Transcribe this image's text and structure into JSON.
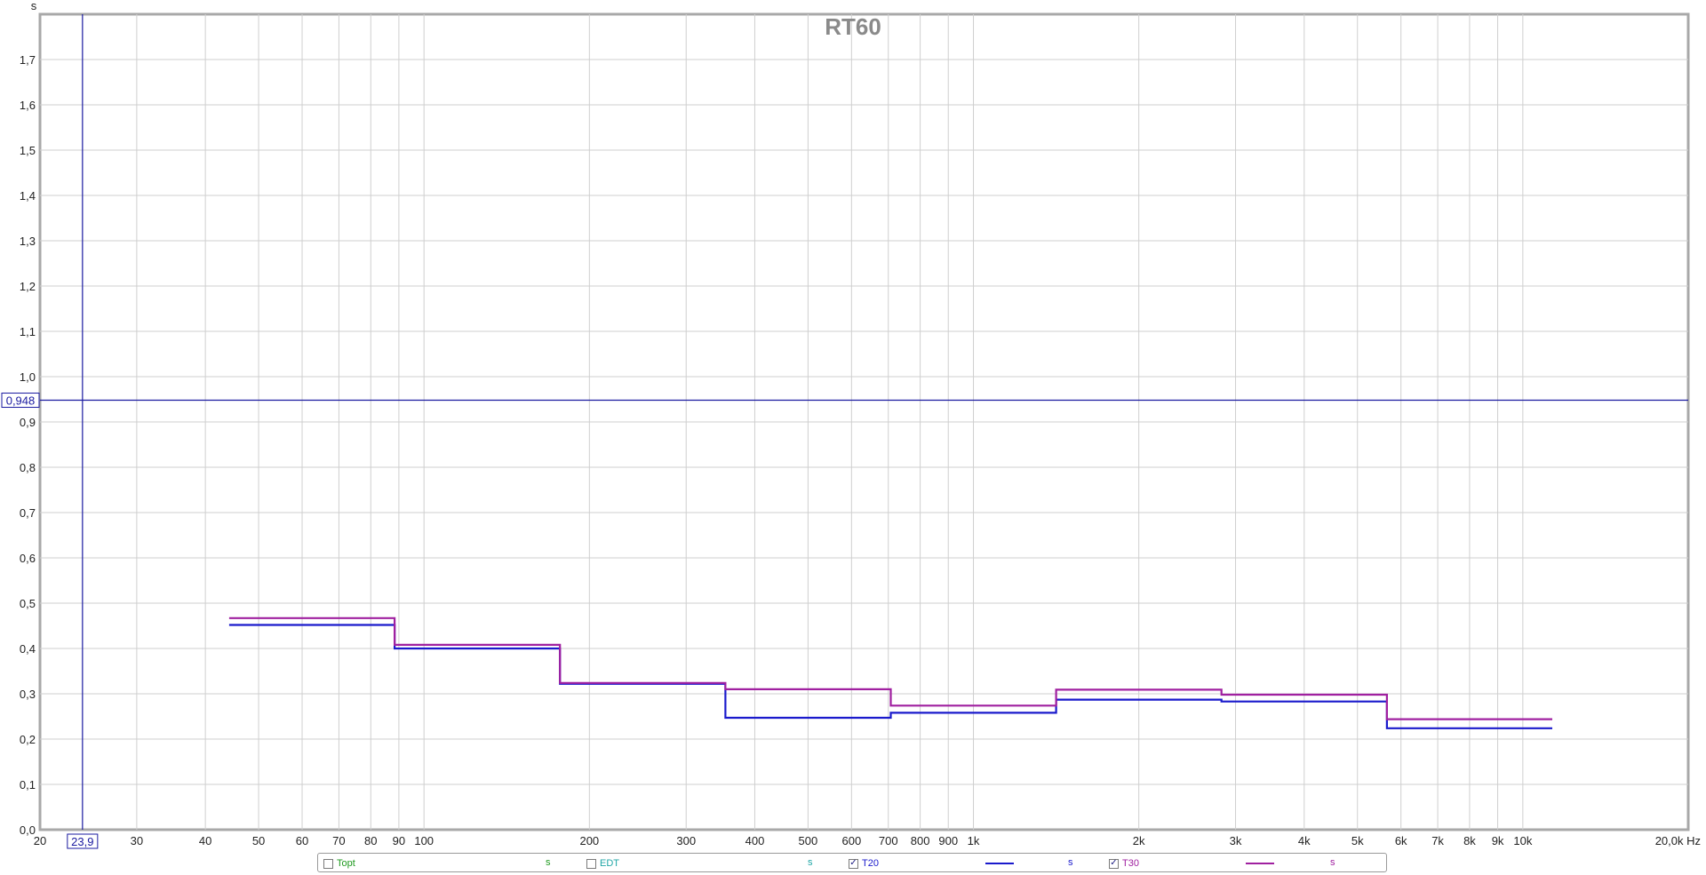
{
  "chart_data": {
    "type": "line",
    "title": "RT60",
    "ylabel": "s",
    "xlabel": "Hz",
    "x_scale": "log",
    "xlim": [
      20,
      20000
    ],
    "ylim": [
      0,
      1.8
    ],
    "grid": true,
    "x_ticks": [
      {
        "v": 20,
        "label": "20"
      },
      {
        "v": 30,
        "label": "30"
      },
      {
        "v": 40,
        "label": "40"
      },
      {
        "v": 50,
        "label": "50"
      },
      {
        "v": 60,
        "label": "60"
      },
      {
        "v": 70,
        "label": "70"
      },
      {
        "v": 80,
        "label": "80"
      },
      {
        "v": 90,
        "label": "90"
      },
      {
        "v": 100,
        "label": "100"
      },
      {
        "v": 200,
        "label": "200"
      },
      {
        "v": 300,
        "label": "300"
      },
      {
        "v": 400,
        "label": "400"
      },
      {
        "v": 500,
        "label": "500"
      },
      {
        "v": 600,
        "label": "600"
      },
      {
        "v": 700,
        "label": "700"
      },
      {
        "v": 800,
        "label": "800"
      },
      {
        "v": 900,
        "label": "900"
      },
      {
        "v": 1000,
        "label": "1k"
      },
      {
        "v": 2000,
        "label": "2k"
      },
      {
        "v": 3000,
        "label": "3k"
      },
      {
        "v": 4000,
        "label": "4k"
      },
      {
        "v": 5000,
        "label": "5k"
      },
      {
        "v": 6000,
        "label": "6k"
      },
      {
        "v": 7000,
        "label": "7k"
      },
      {
        "v": 8000,
        "label": "8k"
      },
      {
        "v": 9000,
        "label": "9k"
      },
      {
        "v": 10000,
        "label": "10k"
      },
      {
        "v": 20000,
        "label": "20,0k Hz"
      }
    ],
    "y_ticks": [
      {
        "v": 0.0,
        "label": "0,0"
      },
      {
        "v": 0.1,
        "label": "0,1"
      },
      {
        "v": 0.2,
        "label": "0,2"
      },
      {
        "v": 0.3,
        "label": "0,3"
      },
      {
        "v": 0.4,
        "label": "0,4"
      },
      {
        "v": 0.5,
        "label": "0,5"
      },
      {
        "v": 0.6,
        "label": "0,6"
      },
      {
        "v": 0.7,
        "label": "0,7"
      },
      {
        "v": 0.8,
        "label": "0,8"
      },
      {
        "v": 0.9,
        "label": "0,9"
      },
      {
        "v": 1.0,
        "label": "1,0"
      },
      {
        "v": 1.1,
        "label": "1,1"
      },
      {
        "v": 1.2,
        "label": "1,2"
      },
      {
        "v": 1.3,
        "label": "1,3"
      },
      {
        "v": 1.4,
        "label": "1,4"
      },
      {
        "v": 1.5,
        "label": "1,5"
      },
      {
        "v": 1.6,
        "label": "1,6"
      },
      {
        "v": 1.7,
        "label": "1,7"
      }
    ],
    "cursor": {
      "x": 23.9,
      "x_label": "23,9",
      "y": 0.948,
      "y_label": "0,948",
      "color": "#1a1aa0"
    },
    "band_edges": [
      44.2,
      88.4,
      176.8,
      353.6,
      707.1,
      1414.2,
      2828.4,
      5656.9,
      11313.7
    ],
    "band_centers": [
      62.5,
      125,
      250,
      500,
      1000,
      2000,
      4000,
      8000
    ],
    "series": [
      {
        "name": "T20",
        "color": "#1a1acc",
        "values": [
          0.452,
          0.4,
          0.322,
          0.247,
          0.258,
          0.287,
          0.283,
          0.224
        ]
      },
      {
        "name": "T30",
        "color": "#a020a0",
        "values": [
          0.467,
          0.408,
          0.324,
          0.31,
          0.274,
          0.309,
          0.298,
          0.244
        ]
      }
    ]
  },
  "legend": {
    "items": [
      {
        "label": "Topt",
        "checked": false,
        "color": "#1f9a1f",
        "unit": "s",
        "check": ""
      },
      {
        "label": "EDT",
        "checked": false,
        "color": "#20a6a6",
        "unit": "s",
        "check": ""
      },
      {
        "label": "T20",
        "checked": true,
        "color": "#1a1acc",
        "unit": "s",
        "check": "✓"
      },
      {
        "label": "T30",
        "checked": true,
        "color": "#a020a0",
        "unit": "s",
        "check": "✓"
      }
    ]
  }
}
